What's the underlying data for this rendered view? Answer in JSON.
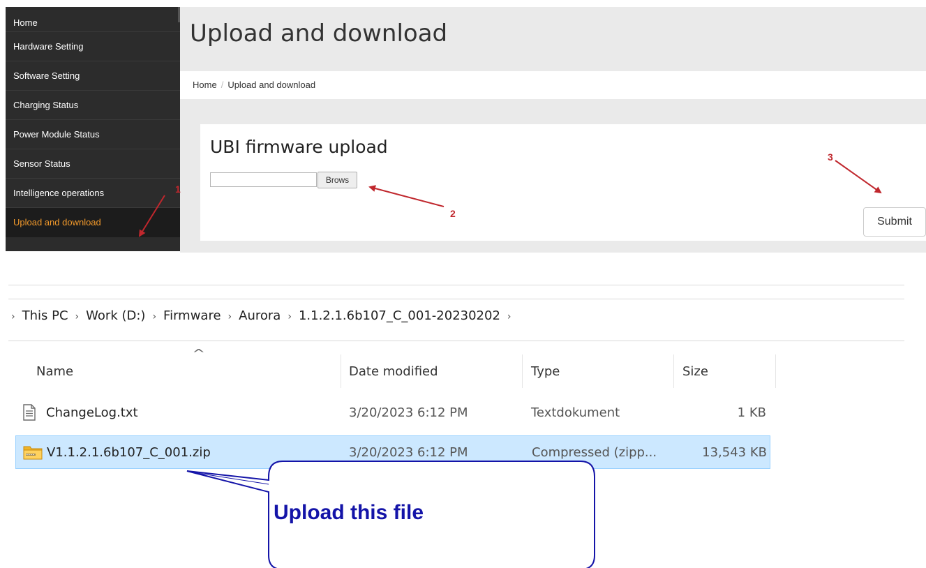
{
  "sidebar": {
    "items": [
      {
        "label": "Home"
      },
      {
        "label": "Hardware Setting"
      },
      {
        "label": "Software Setting"
      },
      {
        "label": "Charging Status"
      },
      {
        "label": "Power Module Status"
      },
      {
        "label": "Sensor Status"
      },
      {
        "label": "Intelligence operations"
      },
      {
        "label": "Upload and download"
      }
    ],
    "active_color": "#f39a2b"
  },
  "header": {
    "title": "Upload and download"
  },
  "breadcrumb": {
    "home": "Home",
    "separator": "/",
    "current": "Upload and download"
  },
  "upload": {
    "title": "UBI firmware upload",
    "file_value": "",
    "browse_label": "Brows",
    "submit_label": "Submit"
  },
  "annotations": {
    "step1": "1",
    "step2": "2",
    "step3": "3",
    "callout": "Upload this file",
    "arrow_color": "#c0272d",
    "callout_color": "#1414a8"
  },
  "explorer": {
    "path": [
      "This PC",
      "Work (D:)",
      "Firmware",
      "Aurora",
      "1.1.2.1.6b107_C_001-20230202"
    ],
    "columns": {
      "name": "Name",
      "date": "Date modified",
      "type": "Type",
      "size": "Size"
    },
    "files": [
      {
        "name": "ChangeLog.txt",
        "date": "3/20/2023 6:12 PM",
        "type": "Textdokument",
        "size": "1 KB",
        "icon": "text-file-icon"
      },
      {
        "name": "V1.1.2.1.6b107_C_001.zip",
        "date": "3/20/2023 6:12 PM",
        "type": "Compressed (zipp...",
        "size": "13,543 KB",
        "icon": "zip-folder-icon",
        "selected": true
      }
    ],
    "selection_color": "#cce8ff"
  }
}
